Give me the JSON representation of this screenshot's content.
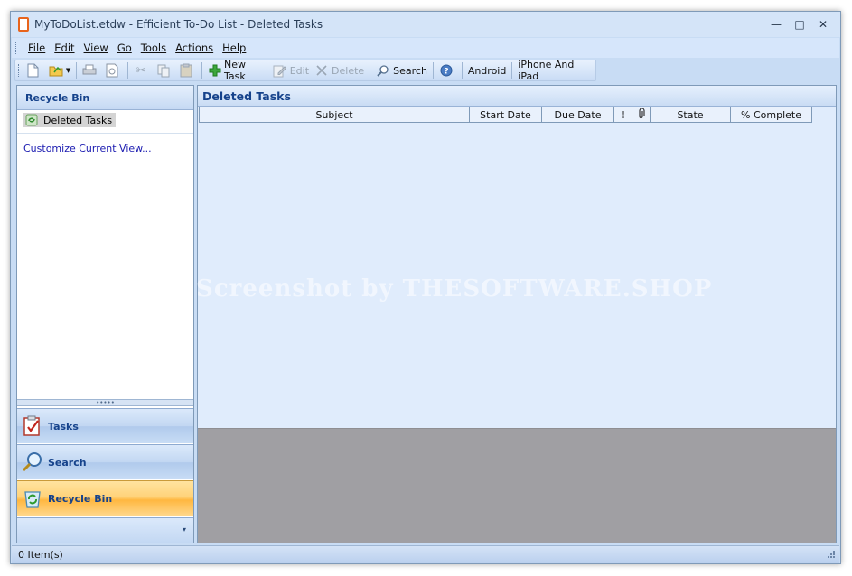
{
  "window": {
    "title": "MyToDoList.etdw - Efficient To-Do List - Deleted Tasks",
    "controls": {
      "minimize": "—",
      "maximize": "□",
      "close": "✕"
    }
  },
  "menu": {
    "items": [
      "File",
      "Edit",
      "View",
      "Go",
      "Tools",
      "Actions",
      "Help"
    ]
  },
  "toolbar": {
    "new_task": "New Task",
    "edit": "Edit",
    "delete": "Delete",
    "search": "Search",
    "android": "Android",
    "iphone": "iPhone And iPad",
    "icons": [
      "new-document-icon",
      "open-folder-icon",
      "print-icon",
      "print-preview-icon",
      "cut-icon",
      "copy-icon",
      "paste-icon",
      "plus-icon",
      "pencil-icon",
      "delete-x-icon",
      "magnifier-icon",
      "help-icon"
    ]
  },
  "left_pane": {
    "header": "Recycle Bin",
    "folder": "Deleted Tasks",
    "customize_link": "Customize Current View...",
    "splitter_dots": "•••••"
  },
  "nav": {
    "tasks": "Tasks",
    "search": "Search",
    "recycle_bin": "Recycle Bin",
    "active": "Recycle Bin"
  },
  "main": {
    "header": "Deleted Tasks",
    "columns": [
      "Subject",
      "Start Date",
      "Due Date",
      "!",
      "📎",
      "State",
      "% Complete"
    ]
  },
  "watermark": "© Screenshot by THESOFTWARE.SHOP",
  "status": {
    "text": "0 Item(s)"
  },
  "colors": {
    "accent": "#15428b",
    "active_nav": "#ffb740",
    "background": "#c8dcf4",
    "preview": "#a09fa3"
  }
}
